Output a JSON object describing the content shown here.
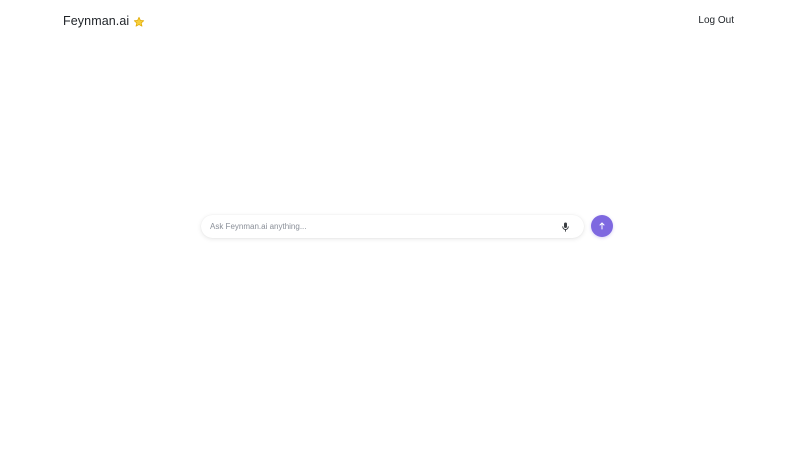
{
  "header": {
    "brand_name": "Feynman.ai",
    "brand_icon": "star-icon",
    "logout_label": "Log Out"
  },
  "search": {
    "placeholder": "Ask Feynman.ai anything...",
    "value": "",
    "mic_icon": "microphone-icon",
    "send_icon": "arrow-up-icon"
  },
  "colors": {
    "accent": "#7e68e0",
    "star": "#f5c518",
    "text": "#1f2328",
    "placeholder": "#8a8f98"
  }
}
